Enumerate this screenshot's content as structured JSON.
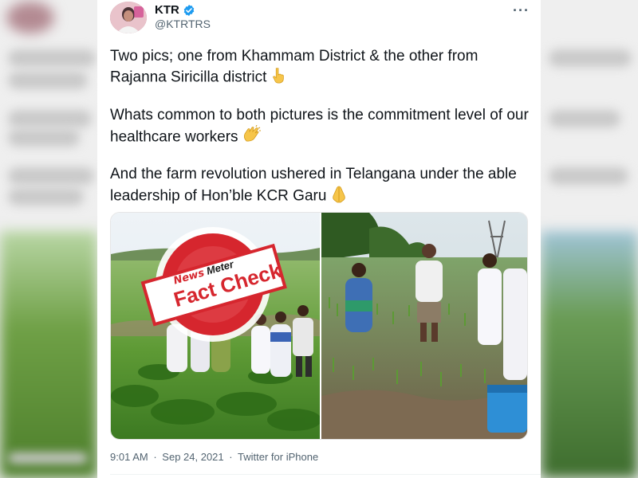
{
  "tweet": {
    "author_name": "KTR",
    "author_handle": "@KTRTRS",
    "paragraphs": [
      "Two pics; one from Khammam District & the other from Rajanna Siricilla district",
      "Whats common to both pictures is the commitment level of our healthcare workers",
      "And the farm revolution ushered in Telangana under the able leadership of Hon’ble KCR Garu"
    ],
    "time": "9:01 AM",
    "date": "Sep 24, 2021",
    "source": "Twitter for iPhone",
    "separator": "·"
  },
  "stamp": {
    "line1": "News",
    "line1_b": "Meter",
    "line2": "Fact Check"
  },
  "icons": {
    "verified": "verified-badge-icon",
    "more": "more-options-icon",
    "emoji1": "pointing-down-emoji",
    "emoji2": "clapping-hands-emoji",
    "emoji3": "folded-hands-emoji"
  },
  "colors": {
    "verified_blue": "#1d9bf0",
    "stamp_red": "#d6262e",
    "text": "#0f1419",
    "muted": "#536471"
  }
}
